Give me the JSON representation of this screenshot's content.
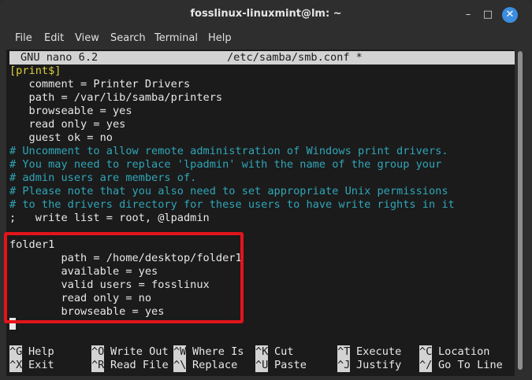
{
  "window": {
    "title": "fosslinux-linuxmint@lm: ~",
    "minimize_glyph": "–",
    "maximize_glyph": "□",
    "close_glyph": "✕"
  },
  "menubar": [
    "File",
    "Edit",
    "View",
    "Search",
    "Terminal",
    "Help"
  ],
  "nano": {
    "version": "GNU nano 6.2",
    "filename": "/etc/samba/smb.conf *"
  },
  "editor_lines": [
    {
      "text": "[print$]",
      "kind": "section"
    },
    {
      "text": "   comment = Printer Drivers",
      "kind": "normal"
    },
    {
      "text": "   path = /var/lib/samba/printers",
      "kind": "normal"
    },
    {
      "text": "   browseable = yes",
      "kind": "normal"
    },
    {
      "text": "   read only = yes",
      "kind": "normal"
    },
    {
      "text": "   guest ok = no",
      "kind": "normal"
    },
    {
      "text": "# Uncomment to allow remote administration of Windows print drivers.",
      "kind": "comment"
    },
    {
      "text": "# You may need to replace 'lpadmin' with the name of the group your",
      "kind": "comment"
    },
    {
      "text": "# admin users are members of.",
      "kind": "comment"
    },
    {
      "text": "# Please note that you also need to set appropriate Unix permissions",
      "kind": "comment"
    },
    {
      "text": "# to the drivers directory for these users to have write rights in it",
      "kind": "comment"
    },
    {
      "text": ";   write list = root, @lpadmin",
      "kind": "normal"
    },
    {
      "text": "",
      "kind": "normal"
    },
    {
      "text": "folder1",
      "kind": "normal"
    },
    {
      "text": "        path = /home/desktop/folder1",
      "kind": "normal"
    },
    {
      "text": "        available = yes",
      "kind": "normal"
    },
    {
      "text": "        valid users = fosslinux",
      "kind": "normal"
    },
    {
      "text": "        read only = no",
      "kind": "normal"
    },
    {
      "text": "        browseable = yes",
      "kind": "normal"
    }
  ],
  "shortcuts": [
    [
      {
        "key": "^G",
        "label": "Help"
      },
      {
        "key": "^O",
        "label": "Write Out"
      },
      {
        "key": "^W",
        "label": "Where Is"
      },
      {
        "key": "^K",
        "label": "Cut"
      },
      {
        "key": "^T",
        "label": "Execute"
      },
      {
        "key": "^C",
        "label": "Location"
      }
    ],
    [
      {
        "key": "^X",
        "label": "Exit"
      },
      {
        "key": "^R",
        "label": "Read File"
      },
      {
        "key": "^\\",
        "label": "Replace"
      },
      {
        "key": "^U",
        "label": "Paste"
      },
      {
        "key": "^J",
        "label": "Justify"
      },
      {
        "key": "^/",
        "label": "Go To Line"
      }
    ]
  ],
  "colors": {
    "highlight_box": "#e3141b",
    "section": "#d9cf3a",
    "comment": "#2fa6b8",
    "terminal_bg": "#1b1b1b"
  }
}
